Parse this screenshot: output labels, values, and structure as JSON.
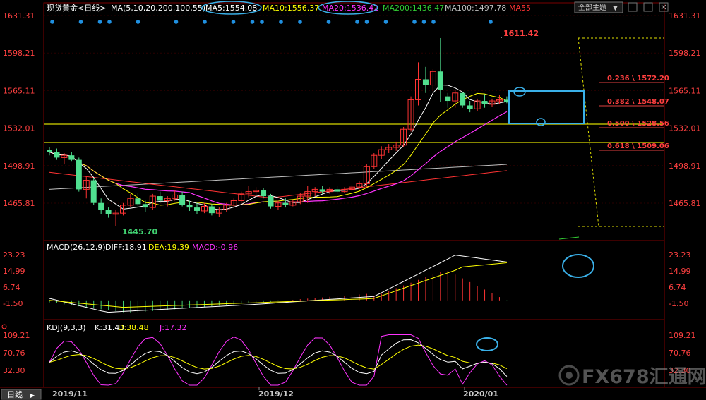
{
  "header": {
    "symbol_title": "现货黄金<日线>",
    "ma_group": "MA(5,10,20,200,100,55)",
    "items": [
      {
        "label": "MA5:1554.08",
        "color": "#ffffff"
      },
      {
        "label": "MA10:1556.37",
        "color": "#ffff00"
      },
      {
        "label": "MA20:1536.42",
        "color": "#ff33ff"
      },
      {
        "label": "MA200:1436.47",
        "color": "#33cc33"
      },
      {
        "label": "MA100:1497.78",
        "color": "#bfbfbf"
      },
      {
        "label": "MA55",
        "color": "#ff3333"
      }
    ],
    "theme_button": "全部主题",
    "theme_arrow": "▼"
  },
  "macd_header": {
    "group": "MACD(26,12,9)",
    "items": [
      {
        "label": "DIFF:18.91",
        "color": "#ffffff"
      },
      {
        "label": "DEA:19.39",
        "color": "#ffff00"
      },
      {
        "label": "MACD:-0.96",
        "color": "#ff33ff"
      }
    ]
  },
  "kdj_header": {
    "group": "KDJ(9,3,3)",
    "items": [
      {
        "label": "K:31.43",
        "color": "#ffffff"
      },
      {
        "label": "D:38.48",
        "color": "#ffff00"
      },
      {
        "label": "J:17.32",
        "color": "#ff33ff"
      }
    ]
  },
  "axis": {
    "price_ticks": [
      "1631.31",
      "1598.21",
      "1565.11",
      "1532.01",
      "1498.91",
      "1465.81"
    ],
    "macd_ticks": [
      "23.23",
      "14.99",
      "6.74",
      "-1.50"
    ],
    "kdj_ticks": [
      "109.21",
      "70.76",
      "32.30"
    ],
    "date_labels": [
      "2019/11",
      "2019/12",
      "2020/01"
    ],
    "period_label": "日线"
  },
  "annotations": {
    "high_label": "1611.42",
    "low_label": "1445.70",
    "fib_levels": [
      "0.236 \\ 1572.20",
      "0.382 \\ 1548.07",
      "0.500 \\ 1528.56",
      "0.618 \\ 1509.06"
    ]
  },
  "watermark": {
    "text": "FX678汇通网"
  },
  "chart_data": {
    "type": "candlestick",
    "price_range": [
      1440,
      1640
    ],
    "candles": [
      {
        "o": 1513,
        "h": 1515,
        "l": 1508,
        "c": 1511
      },
      {
        "o": 1511,
        "h": 1514,
        "l": 1504,
        "c": 1506
      },
      {
        "o": 1506,
        "h": 1510,
        "l": 1500,
        "c": 1508
      },
      {
        "o": 1508,
        "h": 1511,
        "l": 1503,
        "c": 1504
      },
      {
        "o": 1504,
        "h": 1506,
        "l": 1476,
        "c": 1478
      },
      {
        "o": 1478,
        "h": 1490,
        "l": 1470,
        "c": 1486
      },
      {
        "o": 1486,
        "h": 1488,
        "l": 1464,
        "c": 1466
      },
      {
        "o": 1466,
        "h": 1470,
        "l": 1456,
        "c": 1460
      },
      {
        "o": 1460,
        "h": 1462,
        "l": 1453,
        "c": 1456
      },
      {
        "o": 1456,
        "h": 1460,
        "l": 1445.7,
        "c": 1457
      },
      {
        "o": 1457,
        "h": 1466,
        "l": 1455,
        "c": 1464
      },
      {
        "o": 1464,
        "h": 1474,
        "l": 1462,
        "c": 1470
      },
      {
        "o": 1470,
        "h": 1475,
        "l": 1462,
        "c": 1465
      },
      {
        "o": 1465,
        "h": 1468,
        "l": 1458,
        "c": 1462
      },
      {
        "o": 1462,
        "h": 1474,
        "l": 1460,
        "c": 1472
      },
      {
        "o": 1472,
        "h": 1476,
        "l": 1466,
        "c": 1468
      },
      {
        "o": 1468,
        "h": 1472,
        "l": 1463,
        "c": 1470
      },
      {
        "o": 1470,
        "h": 1477,
        "l": 1468,
        "c": 1473
      },
      {
        "o": 1473,
        "h": 1476,
        "l": 1463,
        "c": 1464
      },
      {
        "o": 1464,
        "h": 1468,
        "l": 1459,
        "c": 1462
      },
      {
        "o": 1462,
        "h": 1466,
        "l": 1456,
        "c": 1459
      },
      {
        "o": 1459,
        "h": 1466,
        "l": 1457,
        "c": 1463
      },
      {
        "o": 1463,
        "h": 1465,
        "l": 1455,
        "c": 1457
      },
      {
        "o": 1457,
        "h": 1462,
        "l": 1454,
        "c": 1460
      },
      {
        "o": 1460,
        "h": 1466,
        "l": 1458,
        "c": 1464
      },
      {
        "o": 1464,
        "h": 1470,
        "l": 1462,
        "c": 1468
      },
      {
        "o": 1468,
        "h": 1476,
        "l": 1466,
        "c": 1474
      },
      {
        "o": 1474,
        "h": 1481,
        "l": 1471,
        "c": 1476
      },
      {
        "o": 1476,
        "h": 1480,
        "l": 1472,
        "c": 1477
      },
      {
        "o": 1477,
        "h": 1479,
        "l": 1470,
        "c": 1472
      },
      {
        "o": 1472,
        "h": 1474,
        "l": 1461,
        "c": 1463
      },
      {
        "o": 1463,
        "h": 1468,
        "l": 1460,
        "c": 1466
      },
      {
        "o": 1466,
        "h": 1470,
        "l": 1462,
        "c": 1464
      },
      {
        "o": 1464,
        "h": 1469,
        "l": 1463,
        "c": 1467
      },
      {
        "o": 1467,
        "h": 1475,
        "l": 1465,
        "c": 1472
      },
      {
        "o": 1472,
        "h": 1481,
        "l": 1466,
        "c": 1476
      },
      {
        "o": 1476,
        "h": 1480,
        "l": 1472,
        "c": 1478
      },
      {
        "o": 1478,
        "h": 1481,
        "l": 1474,
        "c": 1476
      },
      {
        "o": 1476,
        "h": 1480,
        "l": 1474,
        "c": 1478
      },
      {
        "o": 1478,
        "h": 1481,
        "l": 1474,
        "c": 1476
      },
      {
        "o": 1476,
        "h": 1480,
        "l": 1475,
        "c": 1478
      },
      {
        "o": 1478,
        "h": 1482,
        "l": 1476,
        "c": 1480
      },
      {
        "o": 1480,
        "h": 1485,
        "l": 1478,
        "c": 1483
      },
      {
        "o": 1483,
        "h": 1500,
        "l": 1481,
        "c": 1498
      },
      {
        "o": 1498,
        "h": 1510,
        "l": 1496,
        "c": 1508
      },
      {
        "o": 1508,
        "h": 1516,
        "l": 1505,
        "c": 1513
      },
      {
        "o": 1513,
        "h": 1518,
        "l": 1510,
        "c": 1515
      },
      {
        "o": 1515,
        "h": 1520,
        "l": 1512,
        "c": 1517
      },
      {
        "o": 1517,
        "h": 1533,
        "l": 1515,
        "c": 1531
      },
      {
        "o": 1531,
        "h": 1560,
        "l": 1529,
        "c": 1557
      },
      {
        "o": 1557,
        "h": 1590,
        "l": 1552,
        "c": 1575
      },
      {
        "o": 1575,
        "h": 1586,
        "l": 1563,
        "c": 1570
      },
      {
        "o": 1570,
        "h": 1584,
        "l": 1565,
        "c": 1582
      },
      {
        "o": 1582,
        "h": 1611.42,
        "l": 1555,
        "c": 1566
      },
      {
        "o": 1560,
        "h": 1563,
        "l": 1550,
        "c": 1556
      },
      {
        "o": 1556,
        "h": 1566,
        "l": 1550,
        "c": 1563
      },
      {
        "o": 1563,
        "h": 1564,
        "l": 1550,
        "c": 1552
      },
      {
        "o": 1552,
        "h": 1556,
        "l": 1546,
        "c": 1549
      },
      {
        "o": 1549,
        "h": 1558,
        "l": 1547,
        "c": 1556
      },
      {
        "o": 1556,
        "h": 1562,
        "l": 1550,
        "c": 1553
      },
      {
        "o": 1553,
        "h": 1558,
        "l": 1551,
        "c": 1556
      },
      {
        "o": 1556,
        "h": 1561,
        "l": 1553,
        "c": 1557
      },
      {
        "o": 1557,
        "h": 1560,
        "l": 1554,
        "c": 1555
      }
    ],
    "macd_range": [
      -6,
      26
    ],
    "kdj_range": [
      0,
      115
    ]
  }
}
